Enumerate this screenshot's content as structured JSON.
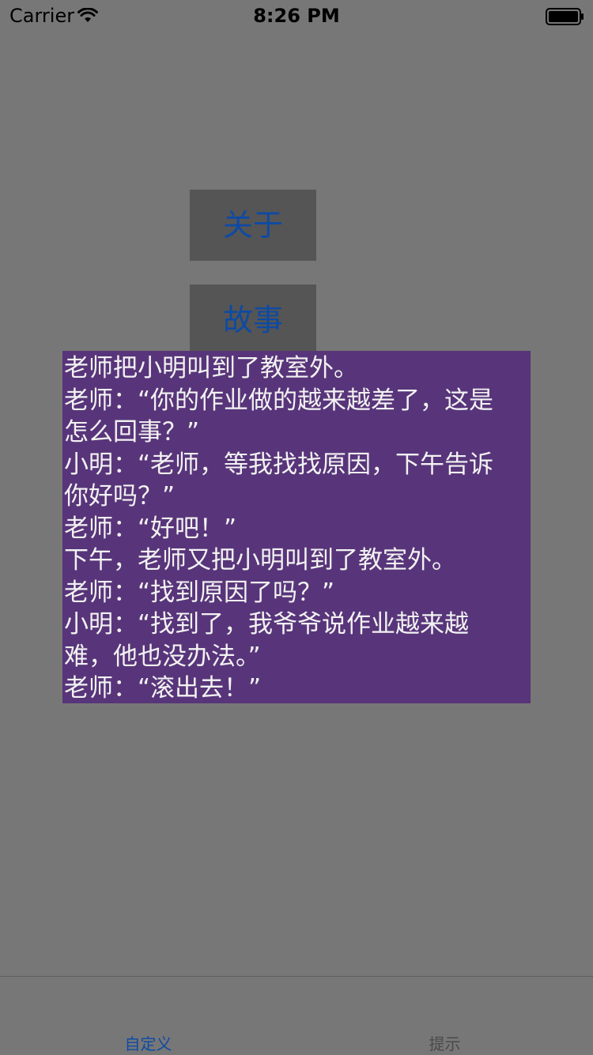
{
  "status_bar": {
    "carrier": "Carrier",
    "time": "8:26 PM"
  },
  "buttons": {
    "about": "关于",
    "story": "故事"
  },
  "story": {
    "lines": [
      "老师把小明叫到了教室外。",
      "老师：“你的作业做的越来越差了，这是",
      "怎么回事？”",
      "小明：“老师，等我找找原因，下午告诉",
      "你好吗？”",
      "老师：“好吧！”",
      "下午，老师又把小明叫到了教室外。",
      "老师：“找到原因了吗？”",
      "小明：“找到了，我爷爷说作业越来越",
      "难，他也没办法。”",
      "老师：“滚出去！”"
    ]
  },
  "tab_bar": {
    "tabs": [
      {
        "label": "自定义"
      },
      {
        "label": "提示"
      }
    ]
  },
  "colors": {
    "background": "#777777",
    "button_bg": "#555555",
    "accent_blue": "#0e4aa3",
    "story_bg": "#58357a"
  }
}
